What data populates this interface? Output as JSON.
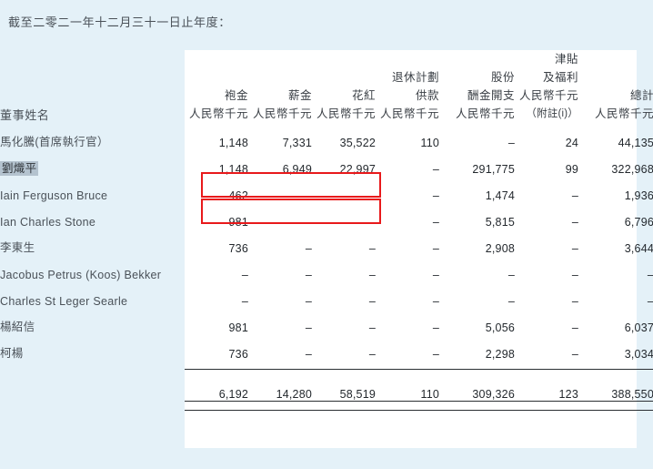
{
  "intro": {
    "text": "截至二零二一年十二月三十一日止年度："
  },
  "table": {
    "row_label_header": "董事姓名",
    "columns": [
      {
        "line1": "",
        "line2": "袍金",
        "unit": "人民幣千元",
        "note": ""
      },
      {
        "line1": "",
        "line2": "薪金",
        "unit": "人民幣千元",
        "note": ""
      },
      {
        "line1": "",
        "line2": "花紅",
        "unit": "人民幣千元",
        "note": ""
      },
      {
        "line1": "退休計劃",
        "line2": "供款",
        "unit": "人民幣千元",
        "note": ""
      },
      {
        "line1": "股份",
        "line2": "酬金開支",
        "unit": "人民幣千元",
        "note": ""
      },
      {
        "line1": "津貼",
        "line2": "及福利",
        "unit": "人民幣千元",
        "note": "（附註(i)）"
      },
      {
        "line1": "",
        "line2": "總計",
        "unit": "人民幣千元",
        "note": ""
      }
    ],
    "rows": [
      {
        "name": "馬化騰(首席執行官）",
        "selected": false,
        "values": [
          "1,148",
          "7,331",
          "35,522",
          "110",
          "–",
          "24",
          "44,135"
        ]
      },
      {
        "name": "劉熾平",
        "selected": true,
        "values": [
          "1,148",
          "6,949",
          "22,997",
          "–",
          "291,775",
          "99",
          "322,968"
        ]
      },
      {
        "name": "Iain Ferguson Bruce",
        "selected": false,
        "values": [
          "462",
          "–",
          "–",
          "–",
          "1,474",
          "–",
          "1,936"
        ]
      },
      {
        "name": "Ian Charles Stone",
        "selected": false,
        "values": [
          "981",
          "–",
          "–",
          "–",
          "5,815",
          "–",
          "6,796"
        ]
      },
      {
        "name": "李東生",
        "selected": false,
        "values": [
          "736",
          "–",
          "–",
          "–",
          "2,908",
          "–",
          "3,644"
        ]
      },
      {
        "name": "Jacobus Petrus (Koos) Bekker",
        "selected": false,
        "values": [
          "–",
          "–",
          "–",
          "–",
          "–",
          "–",
          "–"
        ]
      },
      {
        "name": "Charles St Leger Searle",
        "selected": false,
        "values": [
          "–",
          "–",
          "–",
          "–",
          "–",
          "–",
          "–"
        ]
      },
      {
        "name": "楊紹信",
        "selected": false,
        "values": [
          "981",
          "–",
          "–",
          "–",
          "5,056",
          "–",
          "6,037"
        ]
      },
      {
        "name": "柯楊",
        "selected": false,
        "values": [
          "736",
          "–",
          "–",
          "–",
          "2,298",
          "–",
          "3,034"
        ]
      }
    ],
    "totals": {
      "name": "",
      "values": [
        "6,192",
        "14,280",
        "58,519",
        "110",
        "309,326",
        "123",
        "388,550"
      ]
    }
  },
  "annotations": {
    "rect_1_label": "highlight-row-1-first-three-columns",
    "rect_2_label": "highlight-row-2-first-three-columns",
    "color": "#e8191b"
  },
  "colors": {
    "page_background": "#e4f1f8",
    "panel_background": "#ffffff",
    "text": "#3a3f45",
    "number_text": "#23282d",
    "selection_highlight": "#b4c3cf",
    "rule": "#2b2f33"
  }
}
